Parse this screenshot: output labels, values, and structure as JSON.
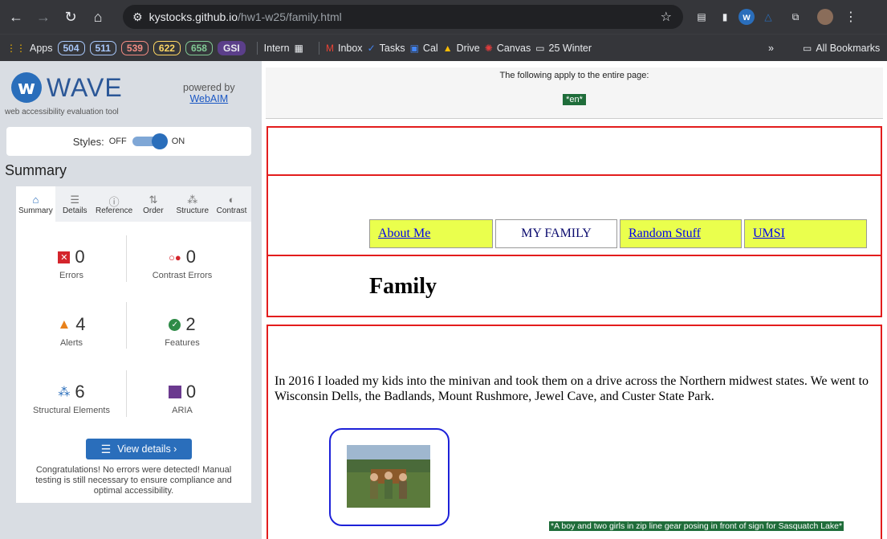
{
  "browser": {
    "url_host": "kystocks.github.io",
    "url_path": "/hw1-w25/family.html",
    "bookmarks": {
      "apps": "Apps",
      "pills": [
        {
          "label": "504",
          "color": "#a8c7fa"
        },
        {
          "label": "511",
          "color": "#a8c7fa"
        },
        {
          "label": "539",
          "color": "#f28b82"
        },
        {
          "label": "622",
          "color": "#fdd663"
        },
        {
          "label": "658",
          "color": "#81c995"
        }
      ],
      "gsi": "GSI",
      "intern": "Intern",
      "inbox": "Inbox",
      "tasks": "Tasks",
      "cal": "Cal",
      "drive": "Drive",
      "canvas": "Canvas",
      "folder": "25 Winter",
      "more": "»",
      "all": "All Bookmarks"
    }
  },
  "wave": {
    "logo_text": "WAVE",
    "tagline": "web accessibility evaluation tool",
    "powered_by": "powered by",
    "webaim": "WebAIM",
    "styles_label": "Styles:",
    "off": "OFF",
    "on": "ON",
    "summary_title": "Summary",
    "tabs": [
      {
        "label": "Summary",
        "icon": "home-icon",
        "glyph": "⌂"
      },
      {
        "label": "Details",
        "icon": "list-icon",
        "glyph": "☰"
      },
      {
        "label": "Reference",
        "icon": "info-icon",
        "glyph": "ⓘ"
      },
      {
        "label": "Order",
        "icon": "order-icon",
        "glyph": "⇅"
      },
      {
        "label": "Structure",
        "icon": "structure-icon",
        "glyph": "⁂"
      },
      {
        "label": "Contrast",
        "icon": "contrast-icon",
        "glyph": "◐"
      }
    ],
    "stats": {
      "errors": {
        "value": "0",
        "label": "Errors"
      },
      "contrast": {
        "value": "0",
        "label": "Contrast Errors"
      },
      "alerts": {
        "value": "4",
        "label": "Alerts"
      },
      "features": {
        "value": "2",
        "label": "Features"
      },
      "structural": {
        "value": "6",
        "label": "Structural Elements"
      },
      "aria": {
        "value": "0",
        "label": "ARIA"
      }
    },
    "view_details": "View details ›",
    "congrats": "Congratulations! No errors were detected! Manual testing is still necessary to ensure compliance and optimal accessibility."
  },
  "page": {
    "doc_info": "The following apply to the entire page:",
    "lang_tag": "*en*",
    "nav": [
      "About Me",
      "MY FAMILY",
      "Random Stuff",
      "UMSI"
    ],
    "heading": "Family",
    "paragraph": "In 2016 I loaded my kids into the minivan and took them on a drive across the Northern midwest states. We went to Wisconsin Dells, the Badlands, Mount Rushmore, Jewel Cave, and Custer State Park.",
    "alt_text": "*A boy and two girls in zip line gear posing in front of sign for Sasquatch Lake*"
  },
  "colors": {
    "wave_blue": "#2a6ebb",
    "error_red": "#e31d1d",
    "nav_yellow": "#eaff4d",
    "tag_green": "#1f6d3a"
  }
}
